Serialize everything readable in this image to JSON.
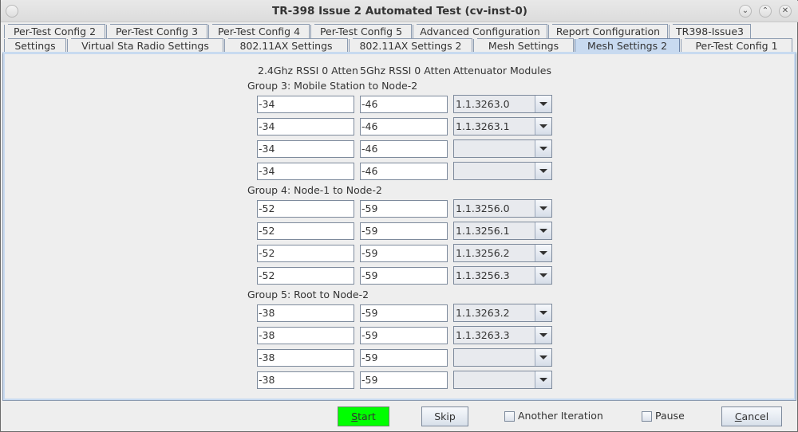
{
  "window": {
    "title": "TR-398 Issue 2 Automated Test  (cv-inst-0)",
    "controls": {
      "minimize": "chevron-down-icon",
      "maximize": "chevron-up-icon",
      "close": "close-icon"
    }
  },
  "tabs": {
    "row1": [
      {
        "label": "Per-Test Config 2"
      },
      {
        "label": "Per-Test Config 3"
      },
      {
        "label": "Per-Test Config 4"
      },
      {
        "label": "Per-Test Config 5"
      },
      {
        "label": "Advanced Configuration"
      },
      {
        "label": "Report Configuration"
      },
      {
        "label": "TR398-Issue3"
      }
    ],
    "row2": [
      {
        "label": "Settings"
      },
      {
        "label": "Virtual Sta Radio Settings"
      },
      {
        "label": "802.11AX Settings"
      },
      {
        "label": "802.11AX Settings 2"
      },
      {
        "label": "Mesh Settings"
      },
      {
        "label": "Mesh Settings 2",
        "active": true
      },
      {
        "label": "Per-Test Config 1"
      }
    ]
  },
  "columns": {
    "col1": "2.4Ghz RSSI 0 Atten",
    "col2": "5Ghz RSSI 0 Atten",
    "col3": "Attenuator Modules"
  },
  "groups": [
    {
      "label": "Group 3: Mobile Station to Node-2",
      "rows": [
        {
          "rssi24": "-34",
          "rssi5": "-46",
          "module": "1.1.3263.0"
        },
        {
          "rssi24": "-34",
          "rssi5": "-46",
          "module": "1.1.3263.1"
        },
        {
          "rssi24": "-34",
          "rssi5": "-46",
          "module": ""
        },
        {
          "rssi24": "-34",
          "rssi5": "-46",
          "module": ""
        }
      ]
    },
    {
      "label": "Group 4: Node-1 to Node-2",
      "rows": [
        {
          "rssi24": "-52",
          "rssi5": "-59",
          "module": "1.1.3256.0"
        },
        {
          "rssi24": "-52",
          "rssi5": "-59",
          "module": "1.1.3256.1"
        },
        {
          "rssi24": "-52",
          "rssi5": "-59",
          "module": "1.1.3256.2"
        },
        {
          "rssi24": "-52",
          "rssi5": "-59",
          "module": "1.1.3256.3"
        }
      ]
    },
    {
      "label": "Group 5: Root to Node-2",
      "rows": [
        {
          "rssi24": "-38",
          "rssi5": "-59",
          "module": "1.1.3263.2"
        },
        {
          "rssi24": "-38",
          "rssi5": "-59",
          "module": "1.1.3263.3"
        },
        {
          "rssi24": "-38",
          "rssi5": "-59",
          "module": ""
        },
        {
          "rssi24": "-38",
          "rssi5": "-59",
          "module": ""
        }
      ]
    }
  ],
  "footer": {
    "start_mnemonic": "S",
    "start_rest": "tart",
    "start_color": "#00ff00",
    "skip_label": "Skip",
    "another_iteration_label": "Another Iteration",
    "another_iteration_checked": false,
    "pause_label": "Pause",
    "pause_checked": false,
    "cancel_mnemonic": "C",
    "cancel_rest": "ancel"
  }
}
